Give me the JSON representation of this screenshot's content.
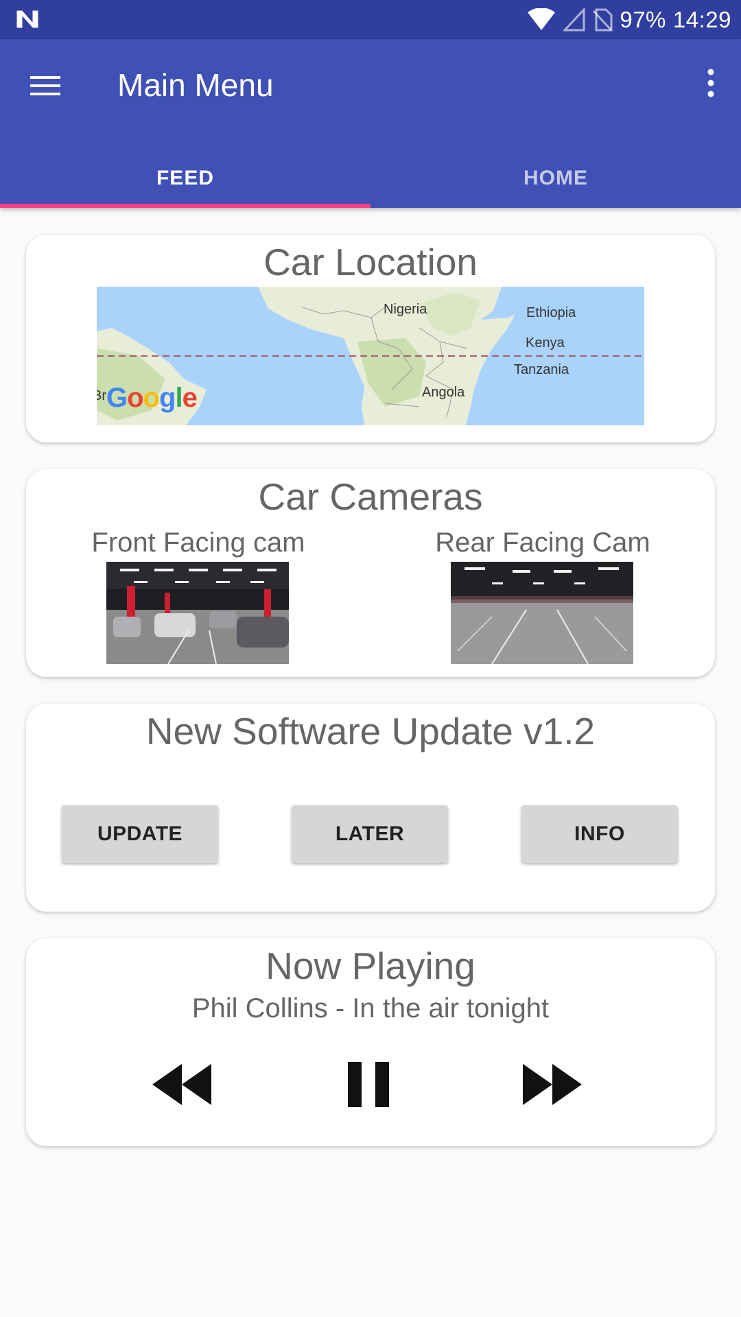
{
  "status_bar": {
    "battery": "97%",
    "time": "14:29",
    "icons": [
      "n-notification-icon",
      "wifi-icon",
      "signal-icon",
      "no-sim-icon"
    ]
  },
  "app_bar": {
    "title": "Main Menu",
    "menu_icon": "hamburger-menu-icon",
    "more_icon": "more-vert-icon"
  },
  "tabs": [
    {
      "label": "FEED",
      "active": true
    },
    {
      "label": "HOME",
      "active": false
    }
  ],
  "colors": {
    "primary": "#3f51b5",
    "primary_dark": "#303f9f",
    "accent": "#ff4081"
  },
  "location_card": {
    "title": "Car Location",
    "map_labels": [
      "Nigeria",
      "Ethiopia",
      "Kenya",
      "Tanzania",
      "Angola",
      "Br"
    ],
    "map_logo": "Google"
  },
  "cameras_card": {
    "title": "Car Cameras",
    "front_label": "Front Facing cam",
    "rear_label": "Rear Facing Cam"
  },
  "update_card": {
    "title": "New Software Update v1.2",
    "buttons": [
      "UPDATE",
      "LATER",
      "INFO"
    ]
  },
  "player_card": {
    "title": "Now Playing",
    "track": "Phil Collins - In the air tonight",
    "controls": [
      "rewind-icon",
      "pause-icon",
      "fast-forward-icon"
    ]
  }
}
